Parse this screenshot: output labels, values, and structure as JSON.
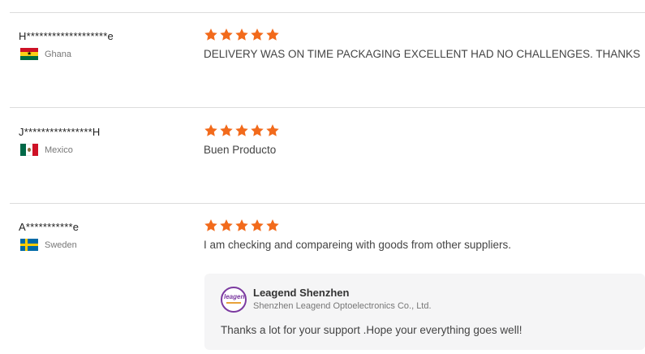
{
  "reviews": [
    {
      "name": "H*******************e",
      "country": "Ghana",
      "flag": "ghana-flag",
      "rating": 5,
      "text": "DELIVERY WAS ON TIME PACKAGING EXCELLENT HAD NO CHALLENGES. THANKS"
    },
    {
      "name": "J****************H",
      "country": "Mexico",
      "flag": "mexico-flag",
      "rating": 5,
      "text": "Buen Producto"
    },
    {
      "name": "A***********e",
      "country": "Sweden",
      "flag": "sweden-flag",
      "rating": 5,
      "text": "I am checking and compareing with goods from other suppliers."
    }
  ],
  "reply": {
    "seller_name": "Leagend Shenzhen",
    "company": "Shenzhen Leagend Optoelectronics Co., Ltd.",
    "text": "Thanks a lot for your support .Hope your everything goes well!",
    "logo_text": "leagend"
  },
  "colors": {
    "star": "#f26a1b",
    "divider": "#dcdcdc",
    "reply_bg": "#f5f5f6",
    "logo_border": "#7b3aa0"
  }
}
